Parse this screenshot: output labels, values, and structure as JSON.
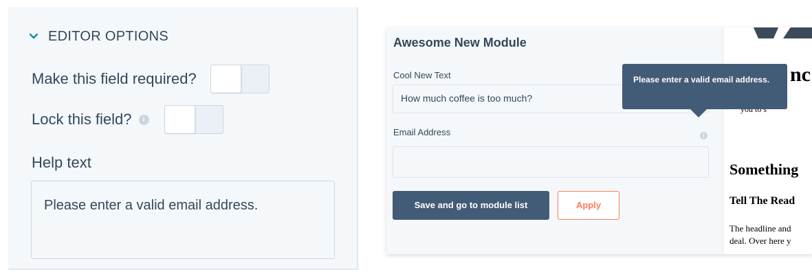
{
  "editor_options": {
    "section_title": "EDITOR OPTIONS",
    "required_label": "Make this field required?",
    "required_value": false,
    "lock_label": "Lock this field?",
    "lock_value": false,
    "info_glyph": "i",
    "help_label": "Help text",
    "help_value": "Please enter a valid email address."
  },
  "module": {
    "title": "Awesome New Module",
    "text_field_label": "Cool New Text",
    "text_field_value": "How much coffee is too much?",
    "email_field_label": "Email Address",
    "email_field_value": "",
    "info_glyph": "i",
    "tooltip": "Please enter a valid email address.",
    "save_button": "Save and go to module list",
    "apply_button": "Apply"
  },
  "preview": {
    "heading_fragment": "nc",
    "small_fragment": "you to s",
    "something": "Something",
    "tell": "Tell The Read",
    "body_line1": "The headline and",
    "body_line2": "deal. Over here y"
  },
  "colors": {
    "text": "#33475b",
    "primary_button": "#425b76",
    "accent": "#ff7a59",
    "panel_bg": "#f5f8fa",
    "border": "#cbd6e2"
  },
  "icons": [
    "chevron-down-icon",
    "info-icon",
    "logo-icon"
  ]
}
